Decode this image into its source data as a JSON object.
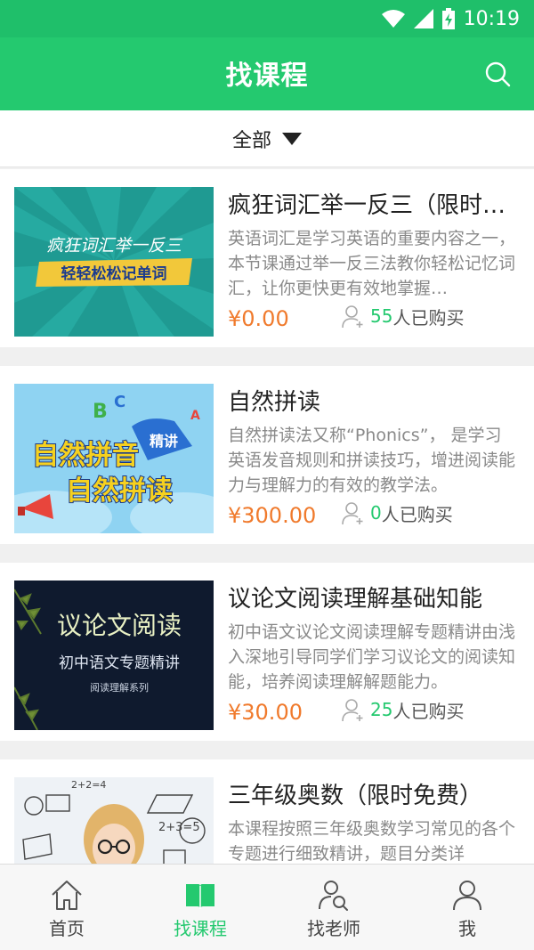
{
  "status_bar": {
    "time": "10:19",
    "icons": [
      "wifi-icon",
      "signal-icon",
      "battery-charging-icon"
    ]
  },
  "header": {
    "title": "找课程",
    "search_icon": "search-icon"
  },
  "filter": {
    "label": "全部",
    "icon": "triangle-down-icon"
  },
  "courses": [
    {
      "title": "疯狂词汇举一反三（限时免费）",
      "description": "英语词汇是学习英语的重要内容之一，本节课通过举一反三法教你轻松记忆词汇，让你更快更有效地掌握…",
      "price": "¥0.00",
      "buyers_count": "55",
      "buyers_suffix": "人已购买",
      "thumb": {
        "line1": "疯狂词汇举一反三",
        "line2": "轻轻松松记单词",
        "bg": "#1f9a92",
        "band": "#f2c83a"
      }
    },
    {
      "title": "自然拼读",
      "description": "自然拼读法又称“Phonics”， 是学习英语发音规则和拼读技巧，增进阅读能力与理解力的有效的教学法。",
      "price": "¥300.00",
      "buyers_count": "0",
      "buyers_suffix": "人已购买",
      "thumb": {
        "line1": "自然拼音",
        "line2": "自然拼读",
        "tag": "精讲",
        "bg": "#8fd3f2"
      }
    },
    {
      "title": "议论文阅读理解基础知能",
      "description": "初中语文议论文阅读理解专题精讲由浅入深地引导同学们学习议论文的阅读知能，培养阅读理解解题能力。",
      "price": "¥30.00",
      "buyers_count": "25",
      "buyers_suffix": "人已购买",
      "thumb": {
        "line1": "议论文阅读",
        "line2": "初中语文专题精讲",
        "line3": "阅读理解系列",
        "bg": "#0f1a2e"
      }
    },
    {
      "title": "三年级奥数（限时免费）",
      "description": "本课程按照三年级奥数学习常见的各个专题进行细致精讲，题目分类详",
      "price": "",
      "buyers_count": "",
      "buyers_suffix": "",
      "thumb": {
        "line1": "2+2=4",
        "line2": "2+3=5",
        "bg": "#eef2f6"
      }
    }
  ],
  "tabs": [
    {
      "label": "首页",
      "icon": "home-icon",
      "active": false
    },
    {
      "label": "找课程",
      "icon": "book-icon",
      "active": true
    },
    {
      "label": "找老师",
      "icon": "teacher-search-icon",
      "active": false
    },
    {
      "label": "我",
      "icon": "user-icon",
      "active": false
    }
  ],
  "colors": {
    "primary": "#24c96f",
    "status_bar": "#1fbf6a",
    "price": "#f07a2c",
    "muted_text": "#8a8a8a"
  }
}
